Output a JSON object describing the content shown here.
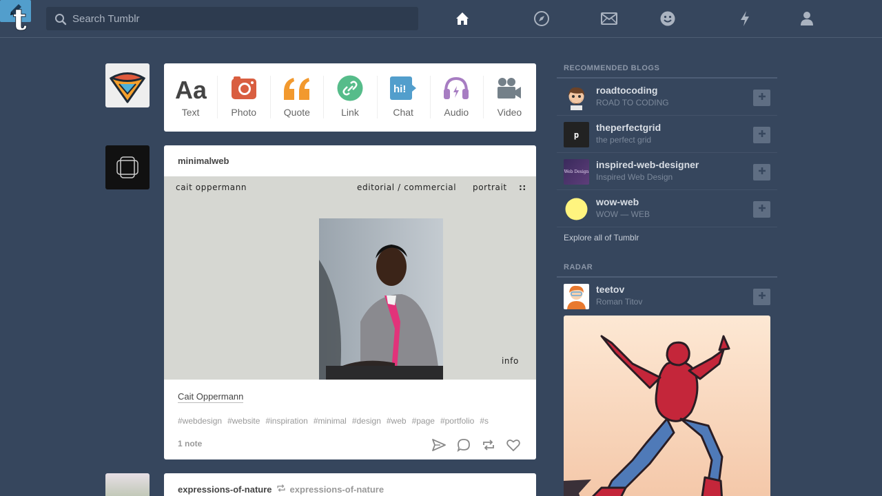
{
  "header": {
    "search_placeholder": "Search Tumblr",
    "nav_icons": [
      "home-icon",
      "compass-icon",
      "mail-icon",
      "smiley-icon",
      "lightning-icon",
      "person-icon"
    ],
    "compose_icon": "pencil-icon",
    "brand_color": "#36465d",
    "accent_color": "#529ecc"
  },
  "post_types": [
    {
      "label": "Text",
      "icon": "text-icon",
      "color": "#444444"
    },
    {
      "label": "Photo",
      "icon": "camera-icon",
      "color": "#d95e40"
    },
    {
      "label": "Quote",
      "icon": "quote-icon",
      "color": "#f2992e"
    },
    {
      "label": "Link",
      "icon": "link-icon",
      "color": "#56bc8a"
    },
    {
      "label": "Chat",
      "icon": "chat-icon",
      "color": "#529ecc"
    },
    {
      "label": "Audio",
      "icon": "headphones-icon",
      "color": "#a77dc2"
    },
    {
      "label": "Video",
      "icon": "video-icon",
      "color": "#748089"
    }
  ],
  "post1": {
    "blog": "minimalweb",
    "photo_text": {
      "name": "cait oppermann",
      "menu1": "editorial / commercial",
      "menu2": "portrait",
      "menu3": "::",
      "corner": "info"
    },
    "caption": "Cait Oppermann",
    "tags": [
      "#webdesign",
      "#website",
      "#inspiration",
      "#minimal",
      "#design",
      "#web",
      "#page",
      "#portfolio",
      "#s"
    ],
    "notes": "1 note"
  },
  "post2": {
    "blog": "expressions-of-nature",
    "reblog_from": "expressions-of-nature"
  },
  "recommended": {
    "title": "RECOMMENDED BLOGS",
    "items": [
      {
        "name": "roadtocoding",
        "sub": "ROAD TO CODING"
      },
      {
        "name": "theperfectgrid",
        "sub": "the perfect grid",
        "badge": "p"
      },
      {
        "name": "inspired-web-designer",
        "sub": "Inspired Web Design",
        "badge": "Web Design"
      },
      {
        "name": "wow-web",
        "sub": "WOW — WEB"
      }
    ],
    "explore": "Explore all of Tumblr"
  },
  "radar": {
    "title": "RADAR",
    "name": "teetov",
    "sub": "Roman Titov"
  }
}
